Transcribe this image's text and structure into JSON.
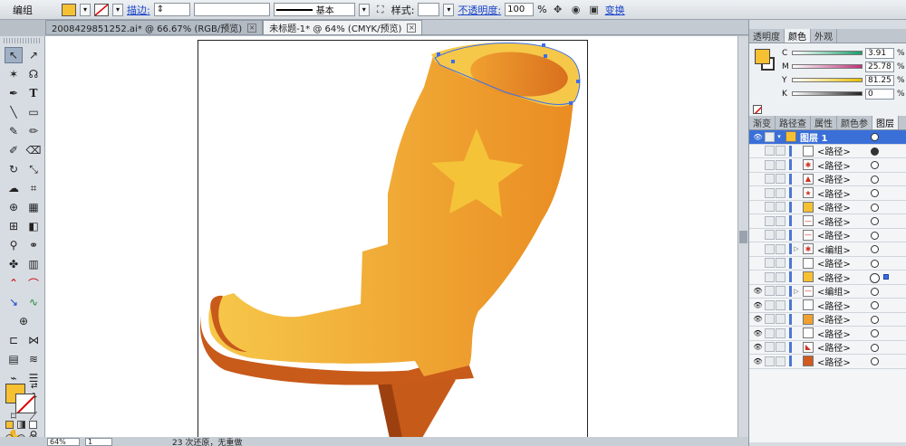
{
  "control": {
    "object_type": "编组",
    "fill_color": "#f6c033",
    "stroke_label": "描边:",
    "stroke_style": "基本",
    "style_label": "样式:",
    "opacity_label": "不透明度:",
    "opacity_value": "100",
    "percent": "%",
    "transform_label": "变换"
  },
  "tabs": [
    {
      "label": "2008429851252.ai* @ 66.67% (RGB/预览)"
    },
    {
      "label": "未标题-1* @ 64% (CMYK/预览)"
    }
  ],
  "close_glyph": "×",
  "status": {
    "zoom": "64%",
    "page": "1",
    "info": "23 次还原，无重做"
  },
  "color_panel": {
    "tabs": [
      "透明度",
      "颜色",
      "外观"
    ],
    "active_tab": "颜色",
    "channels": [
      {
        "label": "C",
        "value": "3.91",
        "color": "#1a9e6b"
      },
      {
        "label": "M",
        "value": "25.78",
        "color": "#c0307c"
      },
      {
        "label": "Y",
        "value": "81.25",
        "color": "#e8c000"
      },
      {
        "label": "K",
        "value": "0",
        "color": "#222222"
      }
    ],
    "pct": "%"
  },
  "layers_panel": {
    "tabs": [
      "渐变",
      "路径查",
      "属性",
      "颜色参",
      "图层"
    ],
    "active_tab": "图层",
    "layer_name": "图层 1",
    "items": [
      {
        "name": "<路径>",
        "thumb": "#ffffff",
        "glyph": ""
      },
      {
        "name": "<路径>",
        "thumb": "#ffffff",
        "glyph": "✱"
      },
      {
        "name": "<路径>",
        "thumb": "#ffffff",
        "glyph": "▲"
      },
      {
        "name": "<路径>",
        "thumb": "#ffffff",
        "glyph": "★"
      },
      {
        "name": "<路径>",
        "thumb": "#f6c033",
        "glyph": ""
      },
      {
        "name": "<路径>",
        "thumb": "#ffffff",
        "glyph": "—"
      },
      {
        "name": "<路径>",
        "thumb": "#ffffff",
        "glyph": "—"
      },
      {
        "name": "<编组>",
        "thumb": "#ffffff",
        "glyph": "✱"
      },
      {
        "name": "<路径>",
        "thumb": "#ffffff",
        "glyph": ""
      },
      {
        "name": "<路径>",
        "thumb": "#f6c033",
        "glyph": ""
      },
      {
        "name": "<编组>",
        "thumb": "#ffffff",
        "glyph": "—"
      },
      {
        "name": "<路径>",
        "thumb": "#ffffff",
        "glyph": ""
      },
      {
        "name": "<路径>",
        "thumb": "#f0a030",
        "glyph": ""
      },
      {
        "name": "<路径>",
        "thumb": "#ffffff",
        "glyph": ""
      },
      {
        "name": "<路径>",
        "thumb": "#ffffff",
        "glyph": "◣"
      },
      {
        "name": "<路径>",
        "thumb": "#d05a20",
        "glyph": ""
      }
    ]
  },
  "art": {
    "boot_light": "#f6c84a",
    "boot_dark": "#ea8c22",
    "sole_color": "#c85a1a",
    "star_color": "#f5c338",
    "selection_color": "#3c6ee8"
  }
}
